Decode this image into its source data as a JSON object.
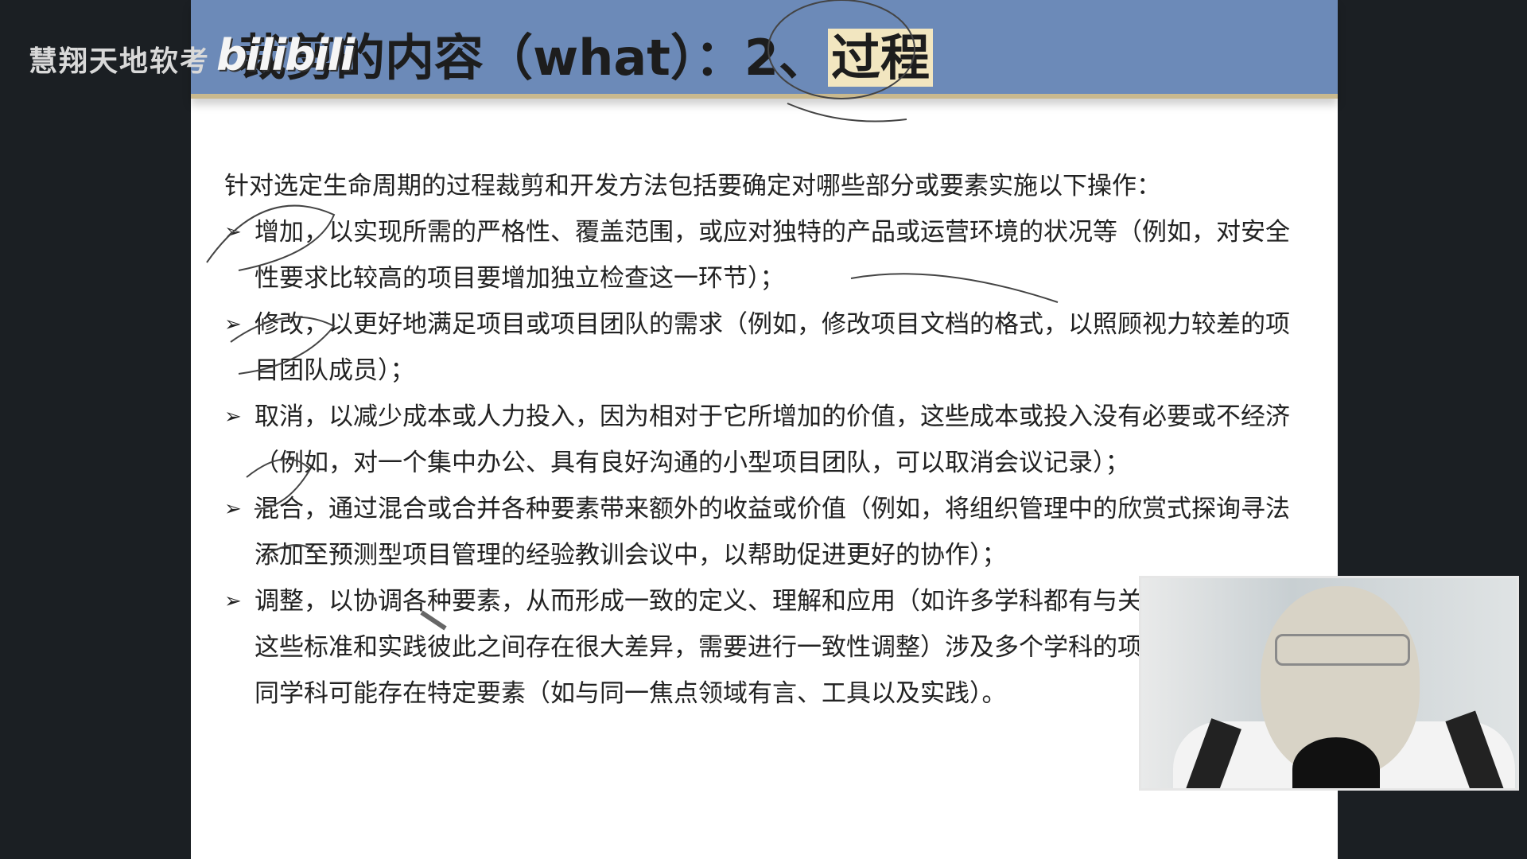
{
  "watermark": "慧翔天地软考",
  "video_logo": "bilibili",
  "slide": {
    "title_prefix": "裁剪的内容（what）：2、",
    "title_highlight": "过程",
    "intro": "针对选定生命周期的过程裁剪和开发方法包括要确定对哪些部分或要素实施以下操作：",
    "bullets": [
      {
        "text": "增加，以实现所需的严格性、覆盖范围，或应对独特的产品或运营环境的状况等（例如，对安全性要求比较高的项目要增加独立检查这一环节）；"
      },
      {
        "text": "修改，以更好地满足项目或项目团队的需求（例如，修改项目文档的格式，以照顾视力较差的项目团队成员）；"
      },
      {
        "text": "取消，以减少成本或人力投入，因为相对于它所增加的价值，这些成本或投入没有必要或不经济（例如，对一个集中办公、具有良好沟通的小型项目团队，可以取消会议记录）；"
      },
      {
        "text": "混合，通过混合或合并各种要素带来额外的收益或价值（例如，将组织管理中的欣赏式探询寻法添加至预测型项目管理的经验教训会议中，以帮助促进更好的协作）；"
      },
      {
        "text": "调整，以协调各种要素，从而形成一致的定义、理解和应用（如许多学科都有与关的标准和实践,这些标准和实践彼此之间存在很大差异，需要进行一致性调整）涉及多个学科的项目团队中，不同学科可能存在特定要素（如与同一焦点领域有言、工具以及实践）。"
      }
    ]
  }
}
